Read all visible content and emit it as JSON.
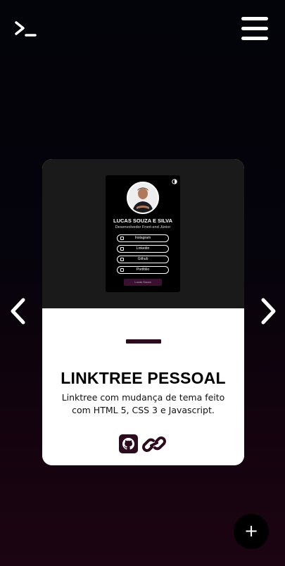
{
  "header": {
    "logo_icon": "terminal-prompt-icon",
    "menu_icon": "hamburger-menu-icon"
  },
  "carousel": {
    "prev_icon": "chevron-left-icon",
    "next_icon": "chevron-right-icon"
  },
  "project": {
    "preview": {
      "name": "LUCAS SOUZA E SILVA",
      "role": "Desenvolvedor Front-end Júnior",
      "links": [
        "Instagram",
        "Linkedin",
        "Github",
        "Portfólio"
      ],
      "footer": "Lucas Souza"
    },
    "title": "LINKTREE PESSOAL",
    "description": "Linktree com mudança de tema feito com HTML 5, CSS 3 e Javascript.",
    "icons": [
      "github-icon",
      "link-icon"
    ],
    "accent_color": "#2d0b1f"
  },
  "fab": {
    "label": "+"
  }
}
